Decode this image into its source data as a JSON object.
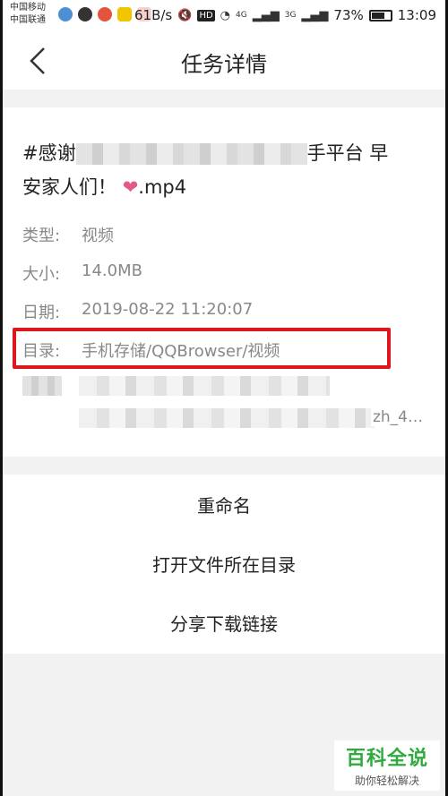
{
  "status_bar": {
    "carrier_1": "中国移动",
    "carrier_2": "中国联通",
    "net_speed": "61B/s",
    "hd": "HD",
    "signal_1": "4G",
    "signal_2": "3G",
    "battery": "73%",
    "battery_level": 0.73,
    "time": "13:09"
  },
  "header": {
    "title": "任务详情"
  },
  "file": {
    "title_start": "#感谢",
    "title_mid": "手平台 早",
    "title_line2": "安家人们！",
    "heart": "❤",
    "title_ext": ".mp4"
  },
  "details": {
    "type_label": "类型:",
    "type_value": "视频",
    "size_label": "大小:",
    "size_value": "14.0MB",
    "date_label": "日期:",
    "date_value": "2019-08-22 11:20:07",
    "dir_label": "目录:",
    "dir_value": "手机存储/QQBrowser/视频",
    "link_tail": "zh_4…"
  },
  "actions": {
    "rename": "重命名",
    "open_dir": "打开文件所在目录",
    "share_link": "分享下载链接"
  },
  "watermark": {
    "main": "百科全说",
    "sub": "助你轻松解决"
  },
  "colors": {
    "highlight": "#e0161d",
    "heart": "#e05a8a",
    "watermark": "#2faa3f"
  }
}
